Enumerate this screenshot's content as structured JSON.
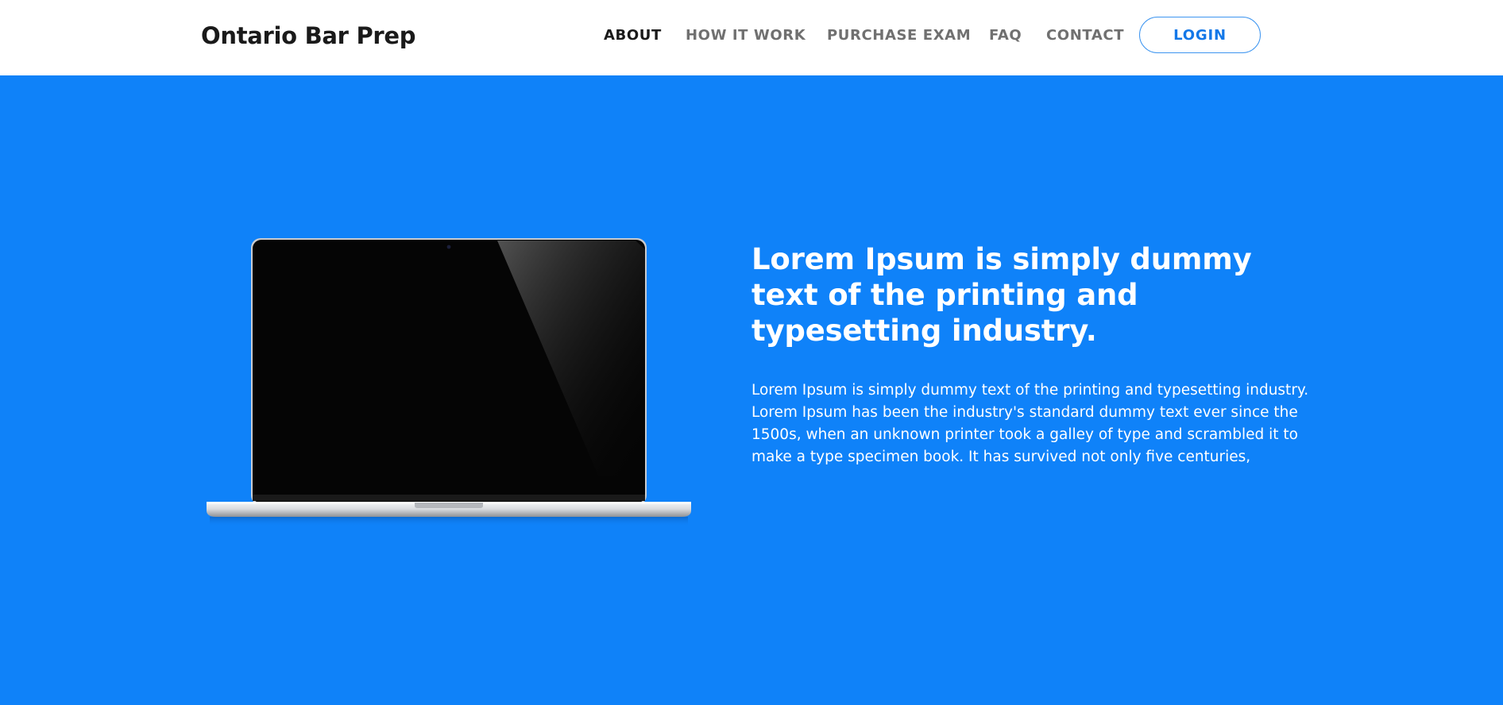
{
  "header": {
    "brand": "Ontario Bar Prep",
    "nav": [
      "ABOUT",
      "HOW IT WORK",
      "PURCHASE EXAM",
      "FAQ",
      "CONTACT"
    ],
    "active_nav": "ABOUT",
    "login_label": "LOGIN"
  },
  "hero": {
    "headline": "Lorem Ipsum is simply dummy text of the printing and typesetting industry.",
    "body": "Lorem Ipsum is simply dummy text of the printing and typesetting industry. Lorem Ipsum has been the industry's standard dummy text ever since the 1500s, when an unknown printer took a galley of type and scrambled it to make a type specimen book. It has survived not only five centuries,",
    "image": "laptop-mockup"
  },
  "colors": {
    "hero_background": "#0f82f9",
    "header_background": "#ffffff",
    "login_border": "#3d95f0",
    "login_text": "#1478e8",
    "nav_active": "#1a1a1a",
    "nav_inactive": "#707070"
  }
}
